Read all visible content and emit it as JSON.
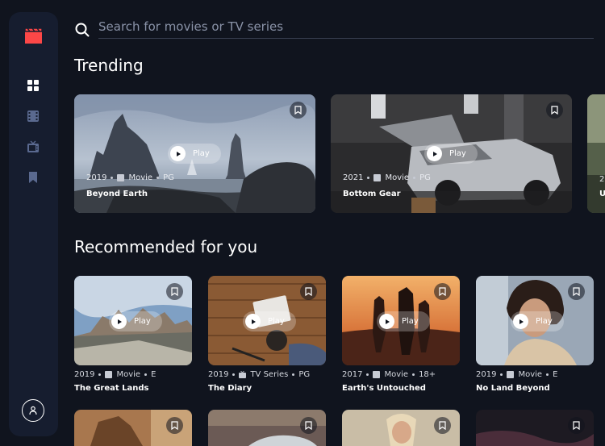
{
  "search": {
    "placeholder": "Search for movies or TV series"
  },
  "sidebar": {
    "items": [
      "home-icon",
      "movies-icon",
      "tv-series-icon",
      "bookmark-icon"
    ],
    "active": "home-icon"
  },
  "trending": {
    "title": "Trending",
    "items": [
      {
        "year": "2019",
        "category": "Movie",
        "rating": "PG",
        "title": "Beyond Earth",
        "play": "Play"
      },
      {
        "year": "2021",
        "category": "Movie",
        "rating": "PG",
        "title": "Bottom Gear",
        "play": "Play"
      },
      {
        "year": "2",
        "title": "U"
      }
    ]
  },
  "recommended": {
    "title": "Recommended for you",
    "items": [
      {
        "year": "2019",
        "category": "Movie",
        "rating": "E",
        "title": "The Great Lands",
        "play": "Play"
      },
      {
        "year": "2019",
        "category": "TV Series",
        "rating": "PG",
        "title": "The Diary",
        "play": "Play"
      },
      {
        "year": "2017",
        "category": "Movie",
        "rating": "18+",
        "title": "Earth's Untouched",
        "play": "Play"
      },
      {
        "year": "2019",
        "category": "Movie",
        "rating": "E",
        "title": "No Land Beyond",
        "play": "Play"
      }
    ]
  },
  "colors": {
    "background": "#10141e",
    "sidebar": "#161d2f",
    "accent": "#fc4747",
    "muted": "#5a698f"
  }
}
